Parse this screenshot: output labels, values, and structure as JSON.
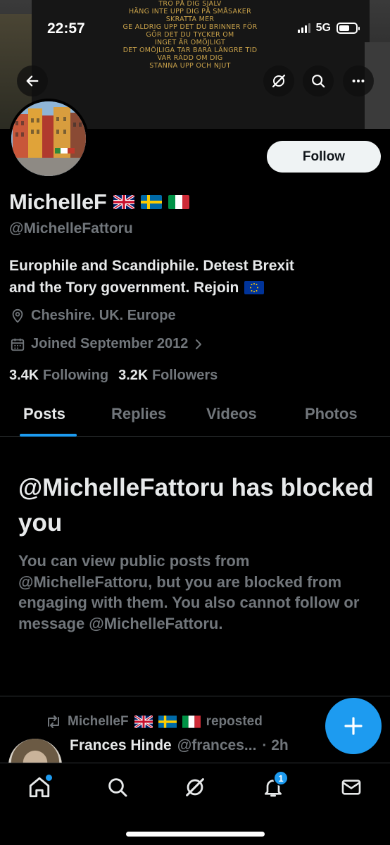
{
  "status_bar": {
    "time": "22:57",
    "network": "5G"
  },
  "banner": {
    "poem_lines": [
      "TRO PÅ DIG SJÄLV",
      "HÄNG INTE UPP DIG PÅ SMÅSAKER",
      "SKRATTA MER",
      "GE ALDRIG UPP DET DU BRINNER FÖR",
      "GÖR DET DU TYCKER OM",
      "INGET ÄR OMÖJLIGT",
      "DET OMÖJLIGA TAR BARA LÄNGRE TID",
      "VAR RÄDD OM DIG",
      "STANNA UPP OCH NJUT"
    ]
  },
  "profile": {
    "name": "MichelleF",
    "handle": "@MichelleFattoru",
    "follow_label": "Follow",
    "bio_line1": "Europhile and Scandiphile. Detest Brexit",
    "bio_line2": "and the Tory government. Rejoin",
    "location": "Cheshire. UK. Europe",
    "joined": "Joined September 2012",
    "following_count": "3.4K",
    "following_label": "Following",
    "followers_count": "3.2K",
    "followers_label": "Followers"
  },
  "tabs": [
    {
      "label": "Posts",
      "active": true
    },
    {
      "label": "Replies",
      "active": false
    },
    {
      "label": "Videos",
      "active": false
    },
    {
      "label": "Photos",
      "active": false
    }
  ],
  "blocked": {
    "title": "@MichelleFattoru has blocked you",
    "body": "You can view public posts from @MichelleFattoru, but you are blocked from engaging with them. You also cannot follow or message @MichelleFattoru."
  },
  "post": {
    "repost_name": "MichelleF",
    "repost_label": "reposted",
    "author_name": "Frances Hinde",
    "author_handle": "@frances...",
    "time": "· 2h"
  },
  "nav": {
    "notification_count": "1"
  },
  "colors": {
    "accent": "#1d9bf0",
    "muted": "#71767b",
    "text": "#e7e9ea",
    "background": "#000000"
  },
  "icons": [
    "back-arrow-icon",
    "grok-icon",
    "search-icon",
    "more-icon",
    "location-pin-icon",
    "calendar-icon",
    "chevron-right-icon",
    "repost-icon",
    "plus-icon",
    "home-icon",
    "bell-icon",
    "mail-icon"
  ]
}
